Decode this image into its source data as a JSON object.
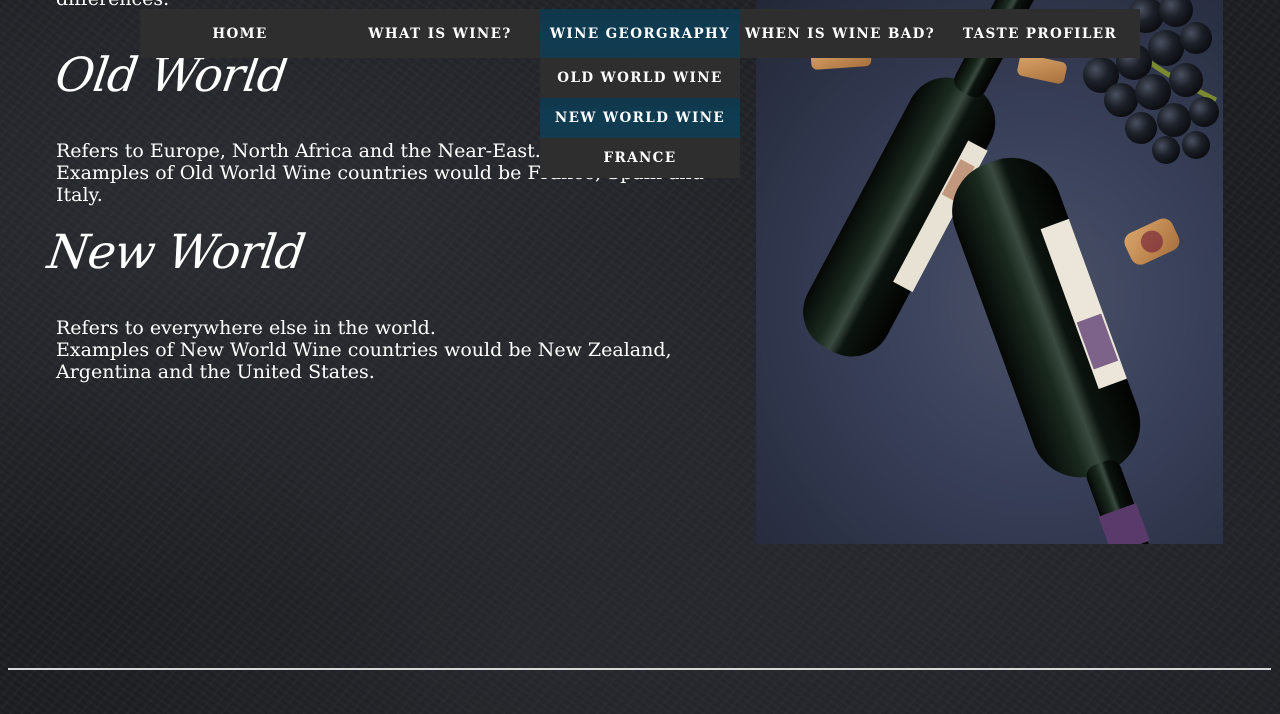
{
  "nav": {
    "items": [
      {
        "label": "HOME"
      },
      {
        "label": "WHAT IS WINE?"
      },
      {
        "label": "WINE GEORGRAPHY"
      },
      {
        "label": "WHEN IS WINE BAD?"
      },
      {
        "label": "TASTE PROFILER"
      }
    ],
    "active_index": 2,
    "dropdown": [
      {
        "label": "OLD WORLD WINE"
      },
      {
        "label": "NEW WORLD WINE"
      },
      {
        "label": "FRANCE"
      }
    ]
  },
  "content": {
    "cut_text": "differences.",
    "old_world": {
      "heading": "Old World",
      "line1": "Refers to Europe, North Africa and the Near-East.",
      "line2": "Examples of Old World Wine countries would be France, Spain and Italy."
    },
    "new_world": {
      "heading": "New World",
      "line1": "Refers to everywhere else in the world.",
      "line2": "Examples of New World Wine countries would be New Zealand, Argentina and the United States."
    }
  },
  "photo": {
    "subject": "wine-bottles-and-grapes"
  },
  "colors": {
    "nav_bg": "#2e2e2e",
    "nav_active": "#0f3c52",
    "text": "#ffffff",
    "page_bg": "#1c1e22"
  }
}
